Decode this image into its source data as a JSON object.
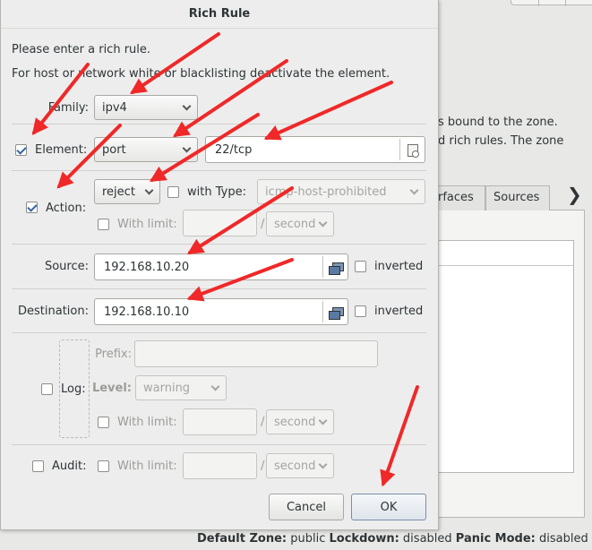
{
  "background": {
    "desc_line1": "s bound to the zone.",
    "desc_line2": "d rich rules. The zone",
    "tabs": [
      "rfaces",
      "Sources"
    ],
    "chevron_glyph": "❯",
    "status": {
      "default_zone_label": "Default Zone:",
      "default_zone_value": " public ",
      "lockdown_label": "Lockdown:",
      "lockdown_value": " disabled ",
      "panic_label": "Panic Mode:",
      "panic_value": " disabled"
    }
  },
  "dialog": {
    "title": "Rich Rule",
    "prompt": "Please enter a rich rule.",
    "hint": "For host or network white or blacklisting deactivate the element.",
    "family": {
      "label": "Family:",
      "value": "ipv4"
    },
    "element": {
      "label": "Element:",
      "checked": true,
      "type": "port",
      "value": "22/tcp"
    },
    "action": {
      "label": "Action:",
      "checked": true,
      "value": "reject",
      "with_type_label": "with Type:",
      "type_value": "icmp-host-prohibited",
      "with_limit_label": "With limit:",
      "limit_value": "",
      "limit_unit": "second"
    },
    "source": {
      "label": "Source:",
      "value": "192.168.10.20",
      "inverted_label": "inverted"
    },
    "destination": {
      "label": "Destination:",
      "value": "192.168.10.10",
      "inverted_label": "inverted"
    },
    "log": {
      "label": "Log:",
      "prefix_label": "Prefix:",
      "prefix_value": "",
      "level_label": "Level:",
      "level_value": "warning",
      "with_limit_label": "With limit:",
      "limit_value": "",
      "limit_unit": "second"
    },
    "audit": {
      "label": "Audit:",
      "with_limit_label": "With limit:",
      "limit_value": "",
      "limit_unit": "second"
    },
    "slash": "/",
    "cancel_label": "Cancel",
    "ok_label": "OK"
  },
  "colors": {
    "arrow": "#f02828",
    "check": "#3465a4"
  }
}
